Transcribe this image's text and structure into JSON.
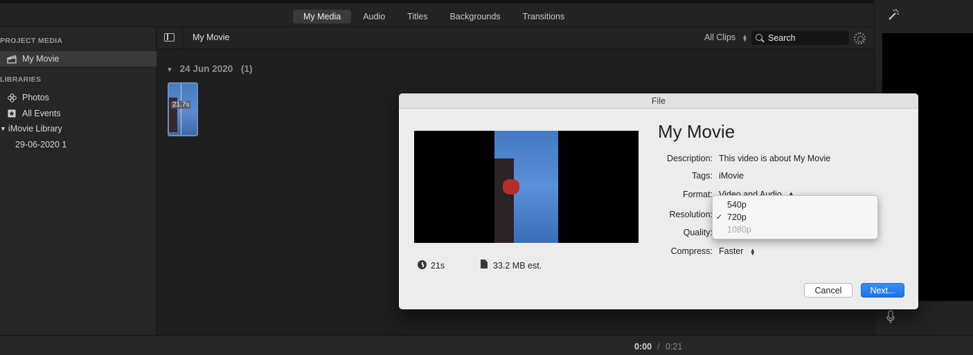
{
  "top_tabs": [
    "My Media",
    "Audio",
    "Titles",
    "Backgrounds",
    "Transitions"
  ],
  "sidebar": {
    "project_media_title": "PROJECT MEDIA",
    "project_item": "My Movie",
    "libraries_title": "LIBRARIES",
    "photos": "Photos",
    "all_events": "All Events",
    "library": "iMovie Library",
    "event": "29-06-2020 1"
  },
  "browser": {
    "title": "My Movie",
    "filter": "All Clips",
    "search_placeholder": "Search",
    "date_group": "24 Jun 2020",
    "date_count": "(1)",
    "clip_duration": "21.7s"
  },
  "timecode": {
    "current": "0:00",
    "separator": "/",
    "total": "0:21"
  },
  "dialog": {
    "window_title": "File",
    "heading": "My Movie",
    "fields": {
      "description_label": "Description:",
      "description_value": "This video is about My Movie",
      "tags_label": "Tags:",
      "tags_value": "iMovie",
      "format_label": "Format:",
      "format_value": "Video and Audio",
      "resolution_label": "Resolution:",
      "quality_label": "Quality:",
      "compress_label": "Compress:",
      "compress_value": "Faster"
    },
    "duration": "21s",
    "filesize": "33.2 MB est.",
    "cancel": "Cancel",
    "next": "Next..."
  },
  "resolution_dropdown": {
    "options": [
      "540p",
      "720p",
      "1080p"
    ],
    "selected": "720p",
    "disabled": [
      "1080p"
    ]
  },
  "colors": {
    "accent_blue": "#1a74e8",
    "dark_bg": "#1f1f1f",
    "dialog_bg": "#ececec"
  }
}
